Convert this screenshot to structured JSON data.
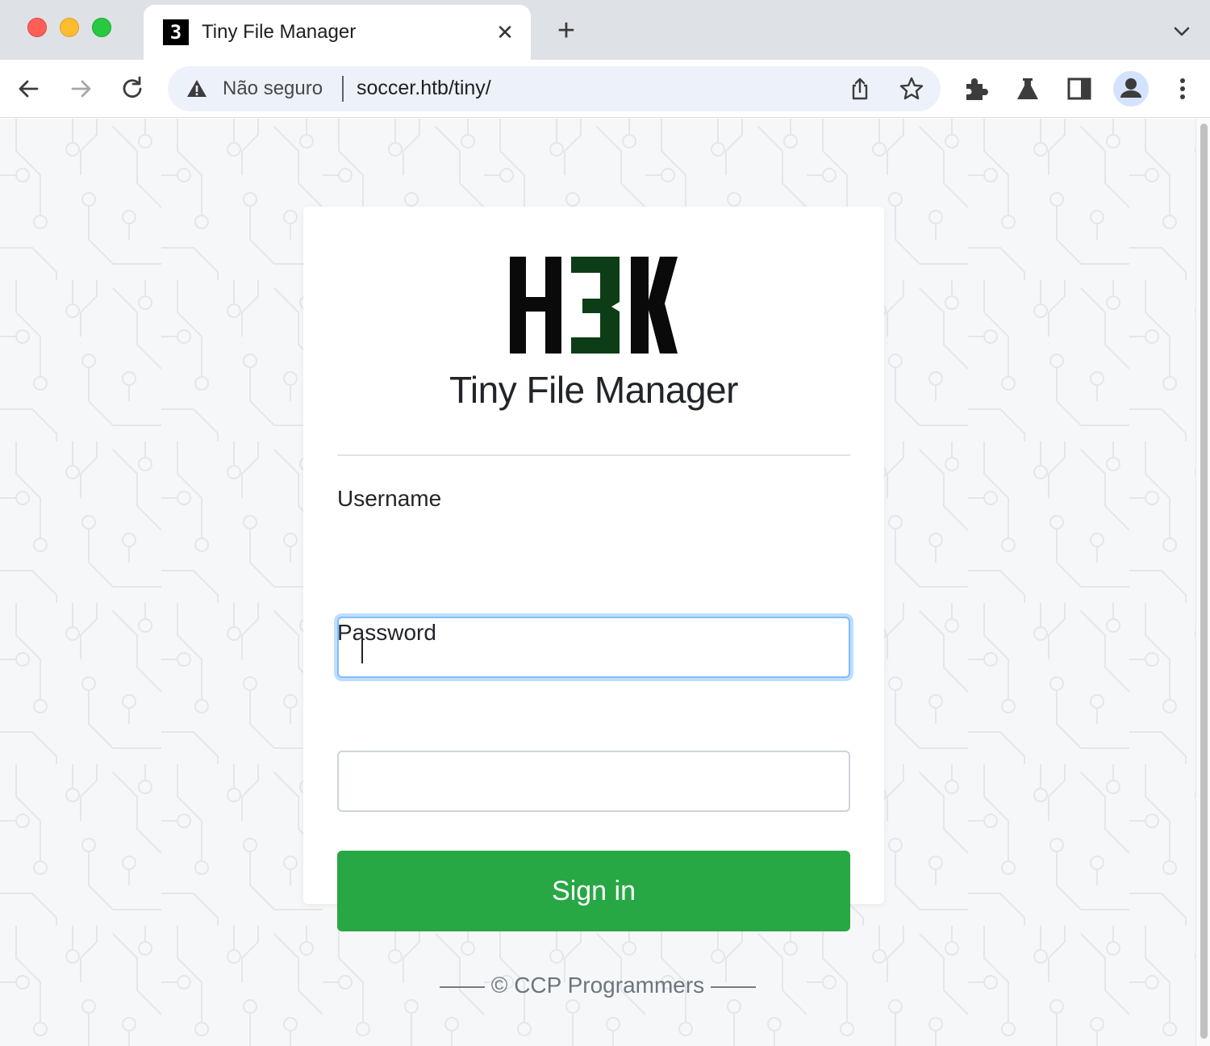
{
  "browser": {
    "tab": {
      "favicon_text": "3",
      "title": "Tiny File Manager",
      "close_glyph": "✕"
    },
    "new_tab_glyph": "+",
    "omnibox": {
      "security_label": "Não seguro",
      "url": "soccer.htb/tiny/"
    },
    "icons": [
      "back-arrow-icon",
      "forward-arrow-icon",
      "reload-icon",
      "warning-icon",
      "share-icon",
      "star-icon",
      "extensions-icon",
      "labs-flask-icon",
      "side-panel-icon",
      "profile-icon",
      "kebab-menu-icon",
      "chevron-down-icon"
    ]
  },
  "login": {
    "logo_text": "H3K",
    "brand": "Tiny File Manager",
    "username_label": "Username",
    "username_value": "",
    "password_label": "Password",
    "password_value": "",
    "signin_label": "Sign in"
  },
  "footer": {
    "text": "—— © CCP Programmers ——"
  },
  "colors": {
    "accent_green": "#28a745",
    "logo_three_green": "#0d3d16",
    "focus_blue": "#80bdff",
    "page_bg": "#f6f7f9"
  }
}
